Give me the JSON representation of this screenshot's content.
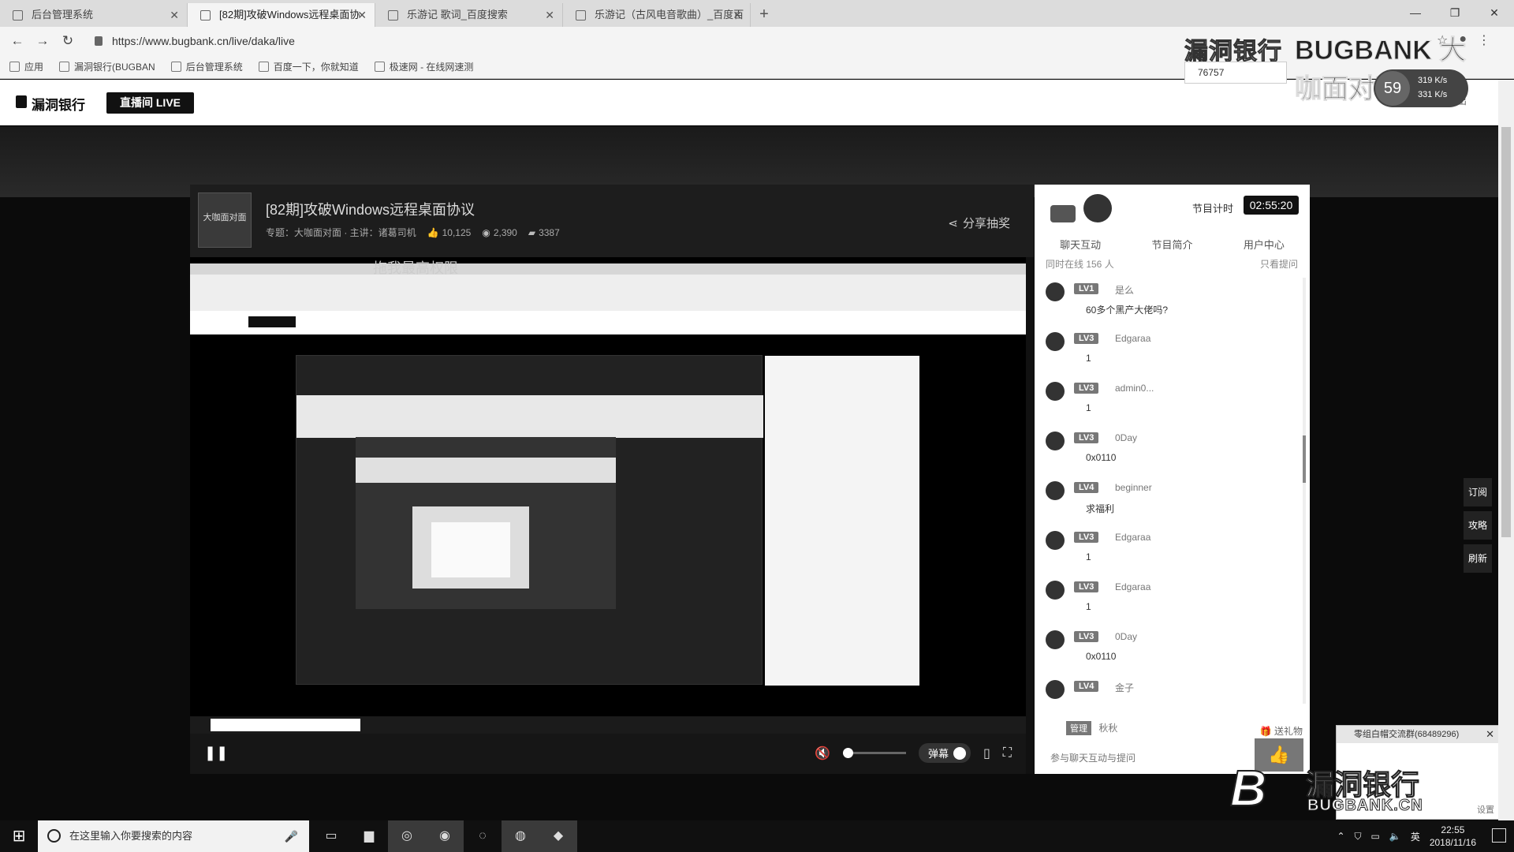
{
  "browser": {
    "tabs": [
      {
        "label": "后台管理系统",
        "active": false
      },
      {
        "label": "[82期]攻破Windows远程桌面协",
        "active": true
      },
      {
        "label": "乐游记 歌词_百度搜索",
        "active": false
      },
      {
        "label": "乐游记（古风电音歌曲）_百度百",
        "active": false
      }
    ],
    "new_tab": "+",
    "url": "https://www.bugbank.cn/live/daka/live",
    "bookmarks": [
      "应用",
      "漏洞银行(BUGBAN",
      "后台管理系统",
      "百度一下，你就知道",
      "极速网 - 在线网速测"
    ]
  },
  "site": {
    "logo": "漏洞银行",
    "live_button": "直播间 LIVE",
    "header_right": "退出"
  },
  "overlay": {
    "brand_cn": "漏洞银行",
    "brand_show": "BUGBANK 大咖面对面",
    "room_number": "76757",
    "net_percent": "59",
    "net_up": "319 K/s",
    "net_down": "331 K/s"
  },
  "player": {
    "thumb_text": "大咖面对面",
    "title": "[82期]攻破Windows远程桌面协议",
    "meta_topic": "专题：大咖面对面 · 主讲：诸葛司机",
    "likes": "10,125",
    "views": "2,390",
    "comments": "3387",
    "share_label": "分享抽奖",
    "video_caption": "拖我最高权限",
    "danmu_label": "弹幕"
  },
  "chat": {
    "timer_label": "节目计时",
    "timer_value": "02:55:20",
    "tabs": [
      "聊天互动",
      "节目简介",
      "用户中心"
    ],
    "online_label": "同时在线 156 人",
    "only_questions": "只看提问",
    "messages": [
      {
        "level": "LV1",
        "name": "是么",
        "text": "60多个黑产大佬吗?"
      },
      {
        "level": "LV3",
        "name": "Edgaraa",
        "text": "1"
      },
      {
        "level": "LV3",
        "name": "admin0...",
        "text": "1"
      },
      {
        "level": "LV3",
        "name": "0Day",
        "text": "0x0110"
      },
      {
        "level": "LV4",
        "name": "beginner",
        "text": "求福利"
      },
      {
        "level": "LV3",
        "name": "Edgaraa",
        "text": "1"
      },
      {
        "level": "LV3",
        "name": "Edgaraa",
        "text": "1"
      },
      {
        "level": "LV3",
        "name": "0Day",
        "text": "0x0110"
      },
      {
        "level": "LV4",
        "name": "金子",
        "text": ""
      }
    ],
    "admin_badge": "管理",
    "admin_name": "秋秋",
    "gift_label": "送礼物",
    "input_placeholder": "参与聊天互动与提问"
  },
  "float_buttons": [
    "订阅",
    "攻略",
    "刷新"
  ],
  "notification": {
    "title": "零组白帽交流群(68489296)",
    "body": "",
    "settings": "设置"
  },
  "watermark": {
    "cn": "漏洞银行",
    "en": "BUGBANK.CN"
  },
  "taskbar": {
    "search_placeholder": "在这里输入你要搜索的内容",
    "time": "22:55",
    "date": "2018/11/16",
    "ime": "英"
  }
}
